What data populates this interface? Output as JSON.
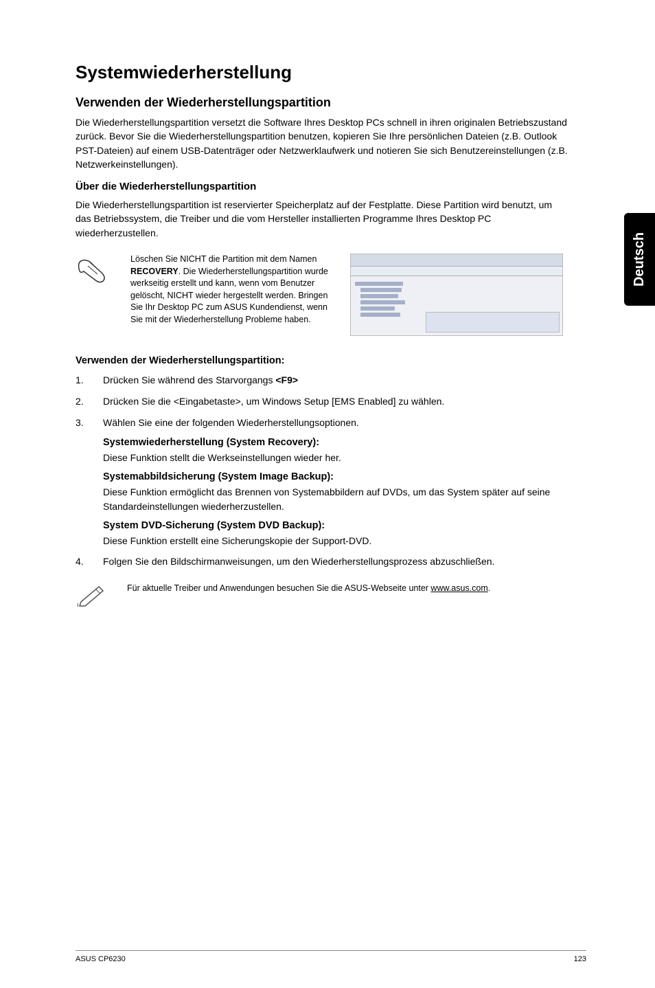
{
  "title": "Systemwiederherstellung",
  "section1": {
    "heading": "Verwenden der Wiederherstellungspartition",
    "p1": "Die Wiederherstellungspartition versetzt die Software Ihres Desktop PCs schnell in ihren originalen Betriebszustand zurück. Bevor Sie die Wiederherstellungspartition benutzen, kopieren Sie Ihre persönlichen Dateien (z.B. Outlook PST-Dateien) auf einem USB-Datenträger oder Netzwerklaufwerk und notieren Sie sich Benutzereinstellungen (z.B. Netzwerkeinstellungen)."
  },
  "section2": {
    "heading": "Über die Wiederherstellungspartition",
    "p1": "Die Wiederherstellungspartition ist reservierter Speicherplatz auf der Festplatte. Diese Partition wird benutzt, um das Betriebssystem, die Treiber und die vom Hersteller installierten Programme Ihres Desktop PC wiederherzustellen."
  },
  "note1": {
    "pre": "Löschen Sie NICHT die Partition mit dem Namen ",
    "bold": "RECOVERY",
    "post": ". Die Wiederherstellungspartition wurde werkseitig erstellt und kann, wenn vom Benutzer gelöscht, NICHT wieder hergestellt werden. Bringen Sie Ihr Desktop PC zum ASUS Kundendienst, wenn Sie mit der Wiederherstellung Probleme haben."
  },
  "steps_heading": "Verwenden der Wiederherstellungspartition:",
  "steps": {
    "s1_pre": "Drücken Sie während des Starvorgangs ",
    "s1_key": "<F9>",
    "s2": "Drücken Sie die <Eingabetaste>, um Windows Setup [EMS Enabled] zu wählen.",
    "s3": "Wählen Sie eine der folgenden Wiederherstellungsoptionen.",
    "sub1_h": "Systemwiederherstellung (System Recovery):",
    "sub1_p": "Diese Funktion stellt die Werkseinstellungen wieder her.",
    "sub2_h": "Systemabbildsicherung (System Image Backup):",
    "sub2_p": "Diese Funktion ermöglicht das Brennen von Systemabbildern auf DVDs, um das System später auf seine Standardeinstellungen wiederherzustellen.",
    "sub3_h": "System DVD-Sicherung (System DVD Backup):",
    "sub3_p": "Diese Funktion erstellt eine Sicherungskopie der Support-DVD.",
    "s4": "Folgen Sie den Bildschirmanweisungen, um den Wiederherstellungsprozess abzuschließen."
  },
  "note2": {
    "pre": "Für aktuelle Treiber und Anwendungen besuchen Sie die ASUS-Webseite unter ",
    "url": "www.asus.com",
    "post": "."
  },
  "sidetab": "Deutsch",
  "footer": {
    "left": "ASUS CP6230",
    "right": "123"
  },
  "nums": {
    "n1": "1.",
    "n2": "2.",
    "n3": "3.",
    "n4": "4."
  }
}
